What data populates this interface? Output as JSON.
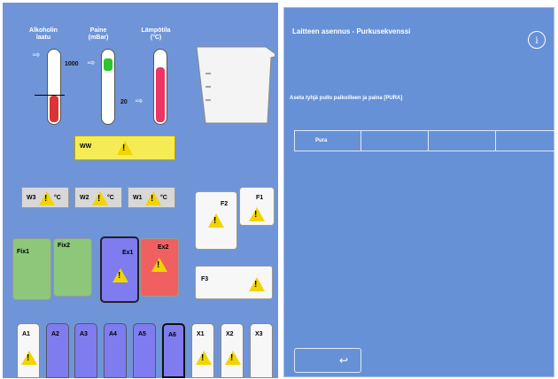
{
  "gauges": {
    "alcohol_label": "Alkoholin laatu",
    "pressure_label": "Paine (mBar)",
    "temp_label": "Lämpötila (°C)",
    "pressure_value": "1000",
    "temp_value": "20"
  },
  "ww_label": "WW",
  "water_labels": [
    "W3",
    "W2",
    "W1"
  ],
  "water_suffix": "°C",
  "fixers": [
    "Fix1",
    "Fix2"
  ],
  "extractants": [
    "Ex1",
    "Ex2"
  ],
  "reagents": [
    "F2",
    "F1",
    "F3"
  ],
  "bottles": [
    "A1",
    "A2",
    "A3",
    "A4",
    "A5",
    "A6",
    "X1",
    "X2",
    "X3"
  ],
  "panel": {
    "title": "Laitteen asennus - Purkusekvenssi",
    "info_icon": "i",
    "instruction": "Aseta tyhjä pullo paikoilleen ja paina [PURA]",
    "tabs": [
      "Pura",
      "",
      "",
      ""
    ],
    "back_icon": "↩"
  }
}
